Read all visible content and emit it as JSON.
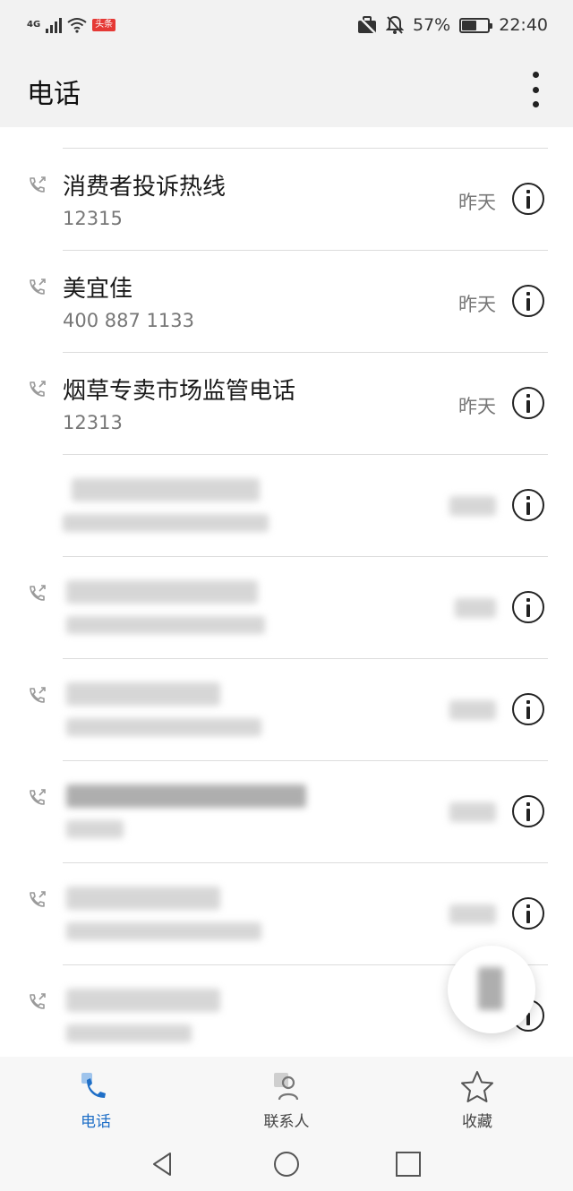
{
  "status_bar": {
    "network": "4G",
    "badge": "头条",
    "battery_percent": "57%",
    "battery_level": 0.57,
    "time": "22:40"
  },
  "app_bar": {
    "title": "电话"
  },
  "calls": [
    {
      "name": "消费者投诉热线",
      "number": "12315",
      "time": "昨天"
    },
    {
      "name": "美宜佳",
      "number": "400 887 1133",
      "time": "昨天"
    },
    {
      "name": "烟草专卖市场监管电话",
      "number": "12313",
      "time": "昨天"
    }
  ],
  "bottom_nav": {
    "phone_label": "电话",
    "contacts_label": "联系人",
    "favorites_label": "收藏"
  },
  "colors": {
    "accent": "#1f6fc7",
    "background": "#f2f2f2",
    "divider": "#dcdcdc"
  }
}
